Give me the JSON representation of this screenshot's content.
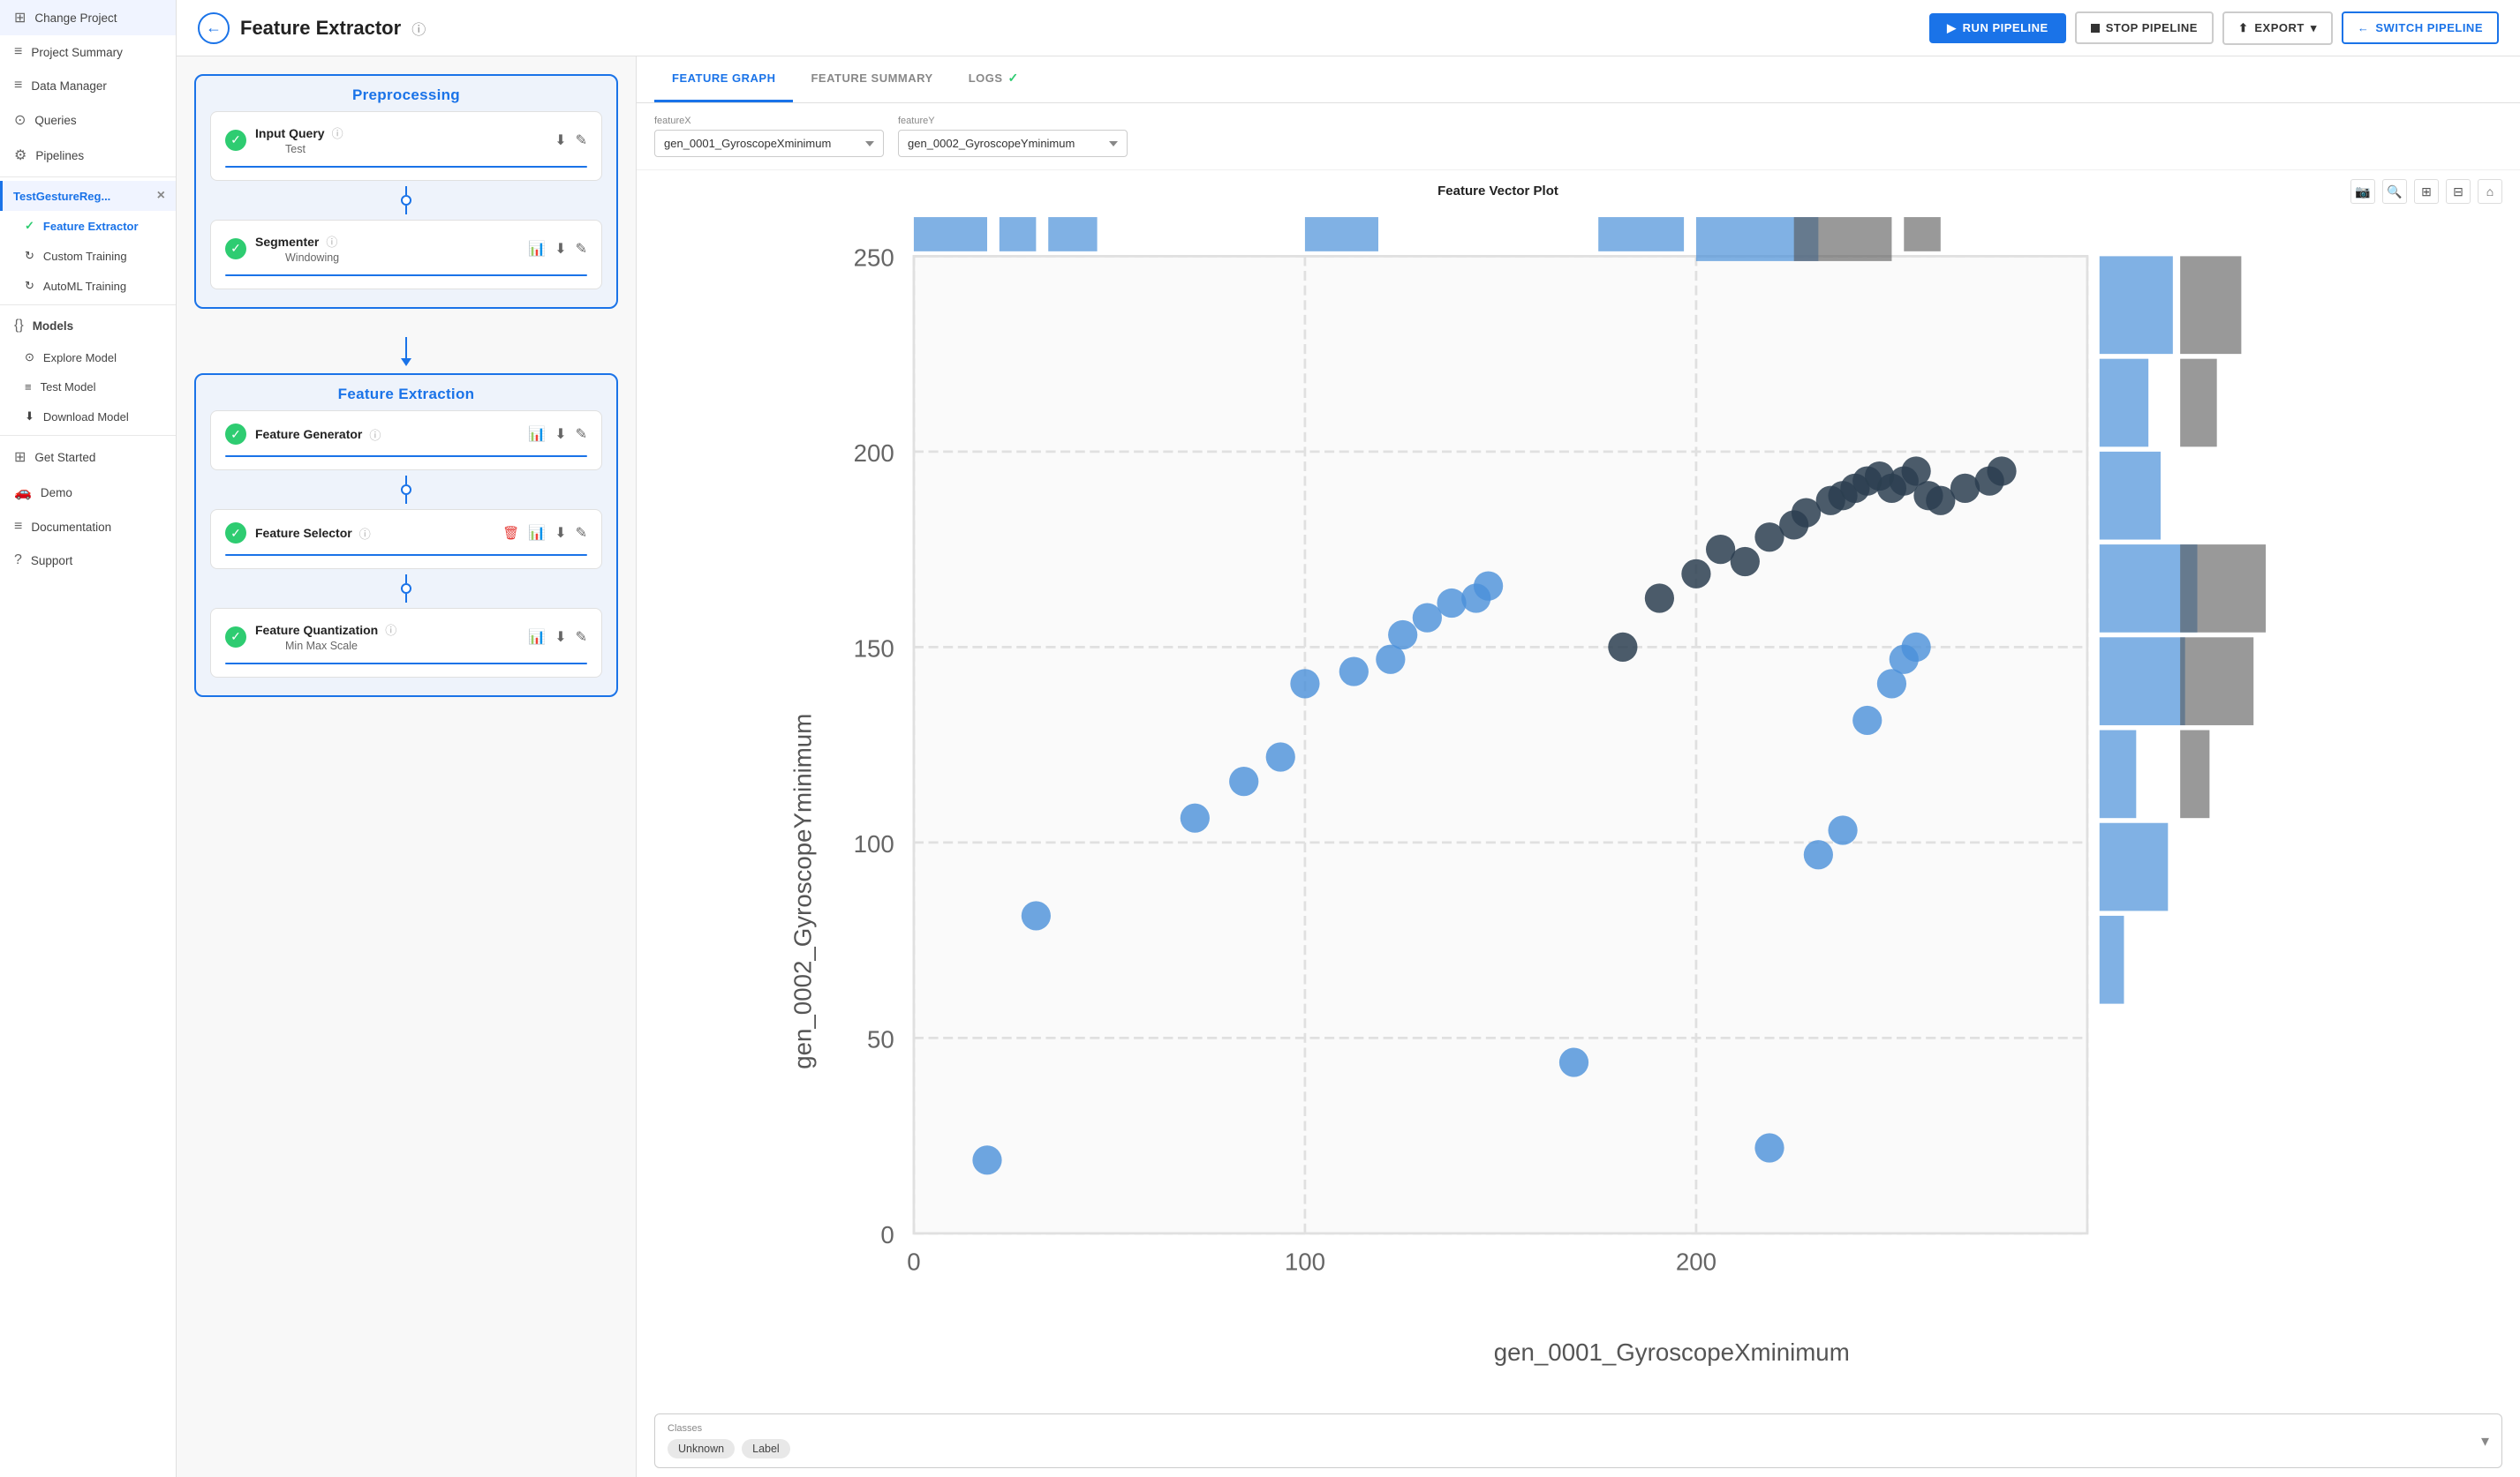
{
  "sidebar": {
    "items": [
      {
        "id": "change-project",
        "label": "Change Project",
        "icon": "⊞"
      },
      {
        "id": "project-summary",
        "label": "Project Summary",
        "icon": "≡"
      },
      {
        "id": "data-manager",
        "label": "Data Manager",
        "icon": "≡"
      },
      {
        "id": "queries",
        "label": "Queries",
        "icon": "⊙"
      },
      {
        "id": "pipelines",
        "label": "Pipelines",
        "icon": "⚙"
      }
    ],
    "active_project": {
      "name": "TestGestureReg...",
      "close_label": "×"
    },
    "sub_items": [
      {
        "id": "feature-extractor",
        "label": "Feature Extractor",
        "icon": "✓",
        "active": true
      },
      {
        "id": "custom-training",
        "label": "Custom Training",
        "icon": "↻"
      },
      {
        "id": "automl-training",
        "label": "AutoML Training",
        "icon": "↻"
      }
    ],
    "models_section": {
      "label": "Models",
      "items": [
        {
          "id": "explore-model",
          "label": "Explore Model",
          "icon": "⊙"
        },
        {
          "id": "test-model",
          "label": "Test Model",
          "icon": "≡"
        },
        {
          "id": "download-model",
          "label": "Download Model",
          "icon": "⬇"
        }
      ]
    },
    "bottom_items": [
      {
        "id": "get-started",
        "label": "Get Started",
        "icon": "⊞"
      },
      {
        "id": "demo",
        "label": "Demo",
        "icon": "🚗"
      },
      {
        "id": "documentation",
        "label": "Documentation",
        "icon": "≡"
      },
      {
        "id": "support",
        "label": "Support",
        "icon": "?"
      }
    ]
  },
  "topbar": {
    "back_btn_label": "←",
    "title": "Feature Extractor",
    "info_icon": "ⓘ",
    "buttons": {
      "run": "RUN PIPELINE",
      "stop": "STOP PIPELINE",
      "export": "EXPORT",
      "switch": "SWITCH PIPELINE"
    }
  },
  "pipeline": {
    "sections": [
      {
        "id": "preprocessing",
        "title": "Preprocessing",
        "steps": [
          {
            "id": "input-query",
            "name": "Input Query",
            "sub": "Test",
            "has_info": true,
            "actions": [
              "download",
              "edit"
            ]
          },
          {
            "id": "segmenter",
            "name": "Segmenter",
            "sub": "Windowing",
            "has_info": true,
            "actions": [
              "chart",
              "download",
              "edit"
            ]
          }
        ]
      },
      {
        "id": "feature-extraction",
        "title": "Feature Extraction",
        "steps": [
          {
            "id": "feature-generator",
            "name": "Feature Generator",
            "sub": "",
            "has_info": true,
            "actions": [
              "chart",
              "download",
              "edit"
            ]
          },
          {
            "id": "feature-selector",
            "name": "Feature Selector",
            "sub": "",
            "has_info": true,
            "actions": [
              "delete",
              "chart",
              "download",
              "edit"
            ]
          },
          {
            "id": "feature-quantization",
            "name": "Feature Quantization",
            "sub": "Min Max Scale",
            "has_info": true,
            "actions": [
              "chart",
              "download",
              "edit"
            ]
          }
        ]
      }
    ]
  },
  "right_panel": {
    "tabs": [
      {
        "id": "feature-graph",
        "label": "FEATURE GRAPH",
        "active": true
      },
      {
        "id": "feature-summary",
        "label": "FEATURE SUMMARY",
        "active": false
      },
      {
        "id": "logs",
        "label": "LOGS",
        "active": false,
        "has_check": true
      }
    ],
    "feature_x": {
      "label": "featureX",
      "value": "gen_0001_GyroscopeXminimum",
      "options": [
        "gen_0001_GyroscopeXminimum",
        "gen_0002_GyroscopeYminimum"
      ]
    },
    "feature_y": {
      "label": "featureY",
      "value": "gen_0002_GyroscopeYminimum",
      "options": [
        "gen_0001_GyroscopeXminimum",
        "gen_0002_GyroscopeYminimum"
      ]
    },
    "graph": {
      "title": "Feature Vector Plot",
      "x_label": "gen_0001_GyroscopeXminimum",
      "y_label": "gen_0002_GyroscopeYminimum",
      "x_ticks": [
        "0",
        "100",
        "200"
      ],
      "y_ticks": [
        "0",
        "50",
        "100",
        "150",
        "200",
        "250"
      ],
      "toolbar": [
        "📷",
        "🔍",
        "⊞",
        "⊟",
        "⌂"
      ]
    },
    "classes": {
      "label": "Classes",
      "chips": [
        "Unknown",
        "Label"
      ]
    }
  }
}
